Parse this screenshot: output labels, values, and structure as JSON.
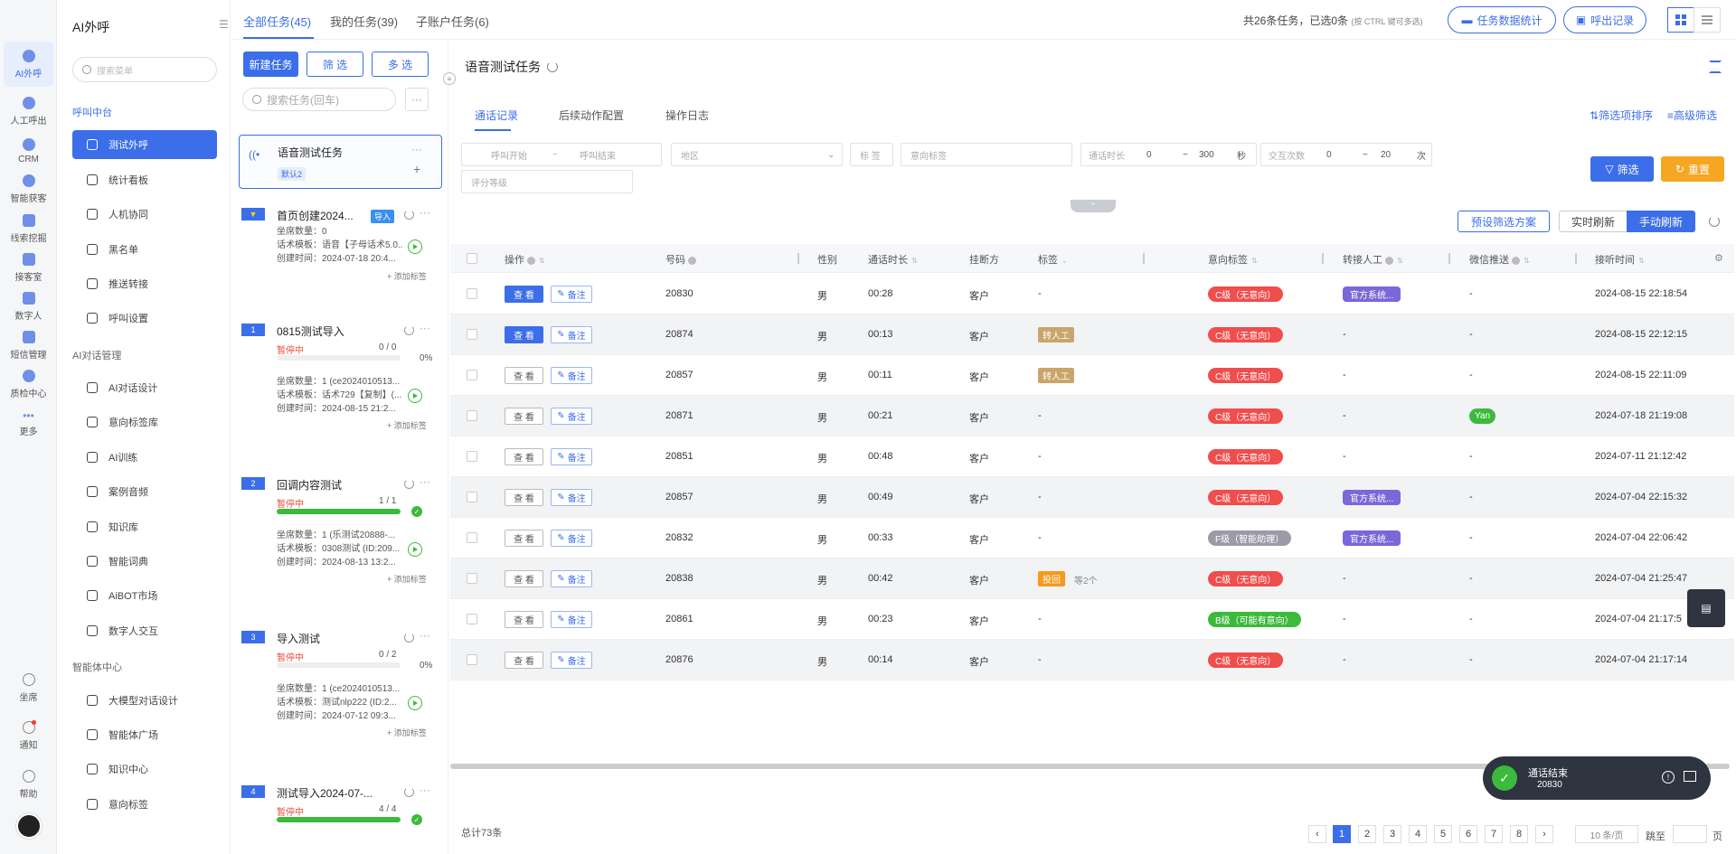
{
  "rail": {
    "items": [
      {
        "label": "AI外呼",
        "active": true
      },
      {
        "label": "人工呼出"
      },
      {
        "label": "CRM"
      },
      {
        "label": "智能获客"
      },
      {
        "label": "线索挖掘"
      },
      {
        "label": "接客室"
      },
      {
        "label": "数字人"
      },
      {
        "label": "短信管理"
      },
      {
        "label": "质检中心"
      },
      {
        "label": "更多"
      }
    ],
    "bottom": [
      {
        "label": "坐席"
      },
      {
        "label": "通知"
      },
      {
        "label": "帮助"
      }
    ]
  },
  "menu": {
    "title": "AI外呼",
    "search_placeholder": "搜索菜单",
    "groups": [
      {
        "label": "呼叫中台",
        "items": [
          "测试外呼",
          "统计看板",
          "人机协同",
          "黑名单",
          "推送转接",
          "呼叫设置"
        ]
      },
      {
        "label": "AI对话管理",
        "items": [
          "AI对话设计",
          "意向标签库",
          "AI训练",
          "案例音频",
          "知识库",
          "智能词典",
          "AiBOT市场",
          "数字人交互"
        ]
      },
      {
        "label": "智能体中心",
        "items": [
          "大模型对话设计",
          "智能体广场",
          "知识中心",
          "意向标签"
        ]
      }
    ]
  },
  "topbar": {
    "tabs": [
      "全部任务(45)",
      "我的任务(39)",
      "子账户任务(6)"
    ],
    "info": "共26条任务，已选0条",
    "info_hint": "(按 CTRL 键可多选)",
    "stats_button": "任务数据统计",
    "export_button": "呼出记录"
  },
  "tasks": {
    "new_button": "新建任务",
    "filter_button": "筛 选",
    "multi_button": "多 选",
    "search_placeholder": "搜索任务(回车)",
    "more": "···",
    "selected": {
      "name": "语音测试任务",
      "badge": "默认2"
    },
    "list": [
      {
        "num": "置顶",
        "name": "首页创建2024...",
        "tag": "导入",
        "meta1": "坐席数量：0",
        "meta2": "话术模板：语音【子母话术5.0...",
        "meta3": "创建时间：2024-07-18 20:4...",
        "addtag": "+ 添加标签"
      },
      {
        "num": "1",
        "name": "0815测试导入",
        "status": "暂停中",
        "ratio": "0 / 0",
        "pct": "0%",
        "progress": 0,
        "meta1": "坐席数量：1 (ce2024010513...",
        "meta2": "话术模板：话术729【复制】(...",
        "meta3": "创建时间：2024-08-15 21:2...",
        "addtag": "+ 添加标签"
      },
      {
        "num": "2",
        "name": "回调内容测试",
        "status": "暂停中",
        "ratio": "1 / 1",
        "progress": 100,
        "meta1": "坐席数量：1 (乐测试20888-...",
        "meta2": "话术模板：0308测试 (ID:209...",
        "meta3": "创建时间：2024-08-13 13:2...",
        "addtag": "+ 添加标签"
      },
      {
        "num": "3",
        "name": "导入测试",
        "status": "暂停中",
        "ratio": "0 / 2",
        "pct": "0%",
        "progress": 0,
        "meta1": "坐席数量：1 (ce2024010513...",
        "meta2": "话术模板：测试nlp222 (ID:2...",
        "meta3": "创建时间：2024-07-12 09:3...",
        "addtag": "+ 添加标签"
      },
      {
        "num": "4",
        "name": "测试导入2024-07-...",
        "status": "暂停中",
        "ratio": "4 / 4",
        "progress": 100
      }
    ]
  },
  "main": {
    "title": "语音测试任务",
    "subtabs": [
      "通话记录",
      "后续动作配置",
      "操作日志"
    ],
    "links": [
      "筛选项排序",
      "高级筛选"
    ],
    "filters": {
      "call_start": "呼叫开始",
      "tilde": "~",
      "call_end": "呼叫结束",
      "region": "地区",
      "tag_label": "标 签",
      "intent_placeholder": "意向标签",
      "duration_label": "通话时长",
      "duration_min": "0",
      "duration_max": "300",
      "duration_unit": "秒",
      "interact_label": "交互次数",
      "interact_min": "0",
      "interact_max": "20",
      "interact_unit": "次",
      "grade_placeholder": "评分等级",
      "filter_button": "筛选",
      "reset_button": "重置"
    },
    "preset_button": "预设筛选方案",
    "realtime_button": "实时刷新",
    "manual_button": "手动刷新",
    "columns": [
      "操作",
      "号码",
      "性别",
      "通话时长",
      "挂断方",
      "标签",
      "意向标签",
      "转接人工",
      "微信推送",
      "接听时间"
    ],
    "view_label": "查 看",
    "note_label": "备注",
    "rows": [
      {
        "num": "20830",
        "gender": "男",
        "dur": "00:28",
        "hangup": "客户",
        "tag": "-",
        "intent": "C级（无意向）",
        "intent_color": "#f04d4d",
        "transfer": "官方系统...",
        "wechat": "-",
        "time": "2024-08-15 22:18:54",
        "solid": true
      },
      {
        "num": "20874",
        "gender": "男",
        "dur": "00:13",
        "hangup": "客户",
        "tag": "转人工",
        "tag_color": "#c9a56a",
        "intent": "C级（无意向）",
        "intent_color": "#f04d4d",
        "transfer": "-",
        "wechat": "-",
        "time": "2024-08-15 22:12:15",
        "solid": true
      },
      {
        "num": "20857",
        "gender": "男",
        "dur": "00:11",
        "hangup": "客户",
        "tag": "转人工",
        "tag_color": "#c9a56a",
        "intent": "C级（无意向）",
        "intent_color": "#f04d4d",
        "transfer": "-",
        "wechat": "-",
        "time": "2024-08-15 22:11:09"
      },
      {
        "num": "20871",
        "gender": "男",
        "dur": "00:21",
        "hangup": "客户",
        "tag": "-",
        "intent": "C级（无意向）",
        "intent_color": "#f04d4d",
        "transfer": "-",
        "wechat": "Yan",
        "time": "2024-07-18 21:19:08"
      },
      {
        "num": "20851",
        "gender": "男",
        "dur": "00:48",
        "hangup": "客户",
        "tag": "-",
        "intent": "C级（无意向）",
        "intent_color": "#f04d4d",
        "transfer": "-",
        "wechat": "-",
        "time": "2024-07-11 21:12:42"
      },
      {
        "num": "20857",
        "gender": "男",
        "dur": "00:49",
        "hangup": "客户",
        "tag": "-",
        "intent": "C级（无意向）",
        "intent_color": "#f04d4d",
        "transfer": "官方系统...",
        "wechat": "-",
        "time": "2024-07-04 22:15:32"
      },
      {
        "num": "20832",
        "gender": "男",
        "dur": "00:33",
        "hangup": "客户",
        "tag": "-",
        "intent": "F级（智能助理）",
        "intent_color": "#9a9aa8",
        "transfer": "官方系统...",
        "wechat": "-",
        "time": "2024-07-04 22:06:42"
      },
      {
        "num": "20838",
        "gender": "男",
        "dur": "00:42",
        "hangup": "客户",
        "tag": "投回",
        "tag_color": "#f59a1b",
        "tag_extra": "等2个",
        "intent": "C级（无意向）",
        "intent_color": "#f04d4d",
        "transfer": "-",
        "wechat": "-",
        "time": "2024-07-04 21:25:47"
      },
      {
        "num": "20861",
        "gender": "男",
        "dur": "00:23",
        "hangup": "客户",
        "tag": "-",
        "intent": "B级（可能有意向）",
        "intent_color": "#3cba3c",
        "transfer": "-",
        "wechat": "-",
        "time": "2024-07-04 21:17:5"
      },
      {
        "num": "20876",
        "gender": "男",
        "dur": "00:14",
        "hangup": "客户",
        "tag": "-",
        "intent": "C级（无意向）",
        "intent_color": "#f04d4d",
        "transfer": "-",
        "wechat": "-",
        "time": "2024-07-04 21:17:14"
      }
    ],
    "total": "总计73条",
    "pages": [
      "1",
      "2",
      "3",
      "4",
      "5",
      "6",
      "7",
      "8"
    ],
    "page_size": "10 条/页",
    "jump_label": "跳至",
    "page_unit": "页"
  },
  "toast": {
    "title": "通话结束",
    "number": "20830"
  },
  "colors": {
    "accent": "#3b6ee8",
    "success": "#3cba3c",
    "danger": "#f04d4d",
    "warning": "#f5a623"
  }
}
